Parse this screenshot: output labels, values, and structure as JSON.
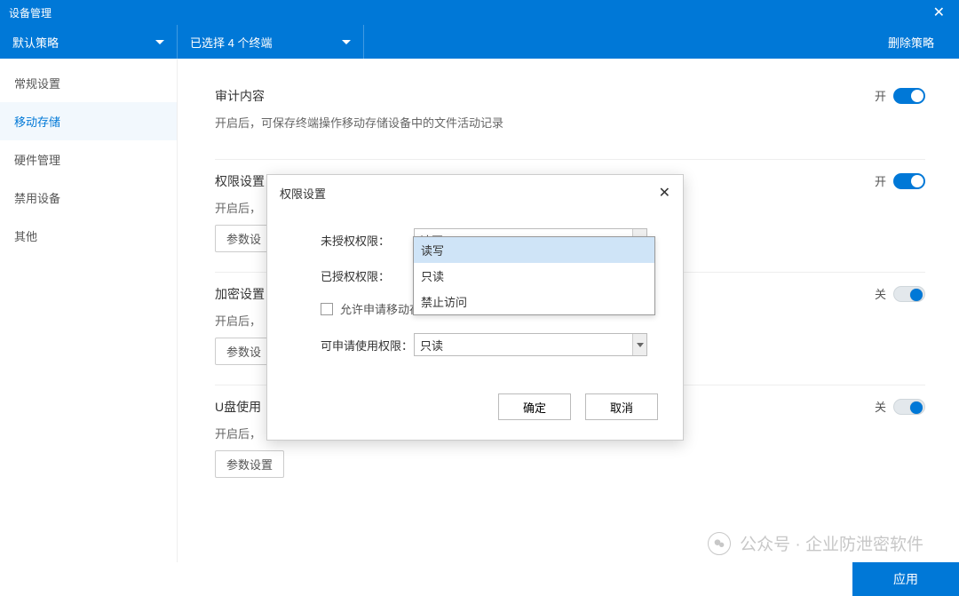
{
  "window": {
    "title": "设备管理",
    "close_aria": "close"
  },
  "toolbar": {
    "policy_label": "默认策略",
    "selected_label": "已选择 4 个终端",
    "delete_btn": "删除策略"
  },
  "sidebar": {
    "items": [
      {
        "label": "常规设置"
      },
      {
        "label": "移动存储"
      },
      {
        "label": "硬件管理"
      },
      {
        "label": "禁用设备"
      },
      {
        "label": "其他"
      }
    ]
  },
  "sections": {
    "audit": {
      "title": "审计内容",
      "desc": "开启后，可保存终端操作移动存储设备中的文件活动记录",
      "toggle_label": "开"
    },
    "perm": {
      "title": "权限设置",
      "desc": "开启后，",
      "param_btn": "参数设",
      "toggle_label": "开"
    },
    "encrypt": {
      "title": "加密设置",
      "desc": "开启后，",
      "param_btn": "参数设",
      "toggle_label": "关"
    },
    "usb": {
      "title": "U盘使用",
      "desc": "开启后，",
      "param_btn": "参数设置",
      "toggle_label": "关"
    }
  },
  "modal": {
    "title": "权限设置",
    "unauth_label": "未授权权限：",
    "unauth_value": "读写",
    "auth_label": "已授权权限：",
    "checkbox_label": "允许申请移动存储使用审批",
    "reqperm_label": "可申请使用权限：",
    "reqperm_value": "只读",
    "ok": "确定",
    "cancel": "取消"
  },
  "dropdown": {
    "options": [
      {
        "label": "读写"
      },
      {
        "label": "只读"
      },
      {
        "label": "禁止访问"
      }
    ]
  },
  "footer": {
    "apply": "应用"
  },
  "watermark": {
    "prefix": "公众号 · ",
    "name": "企业防泄密软件"
  }
}
